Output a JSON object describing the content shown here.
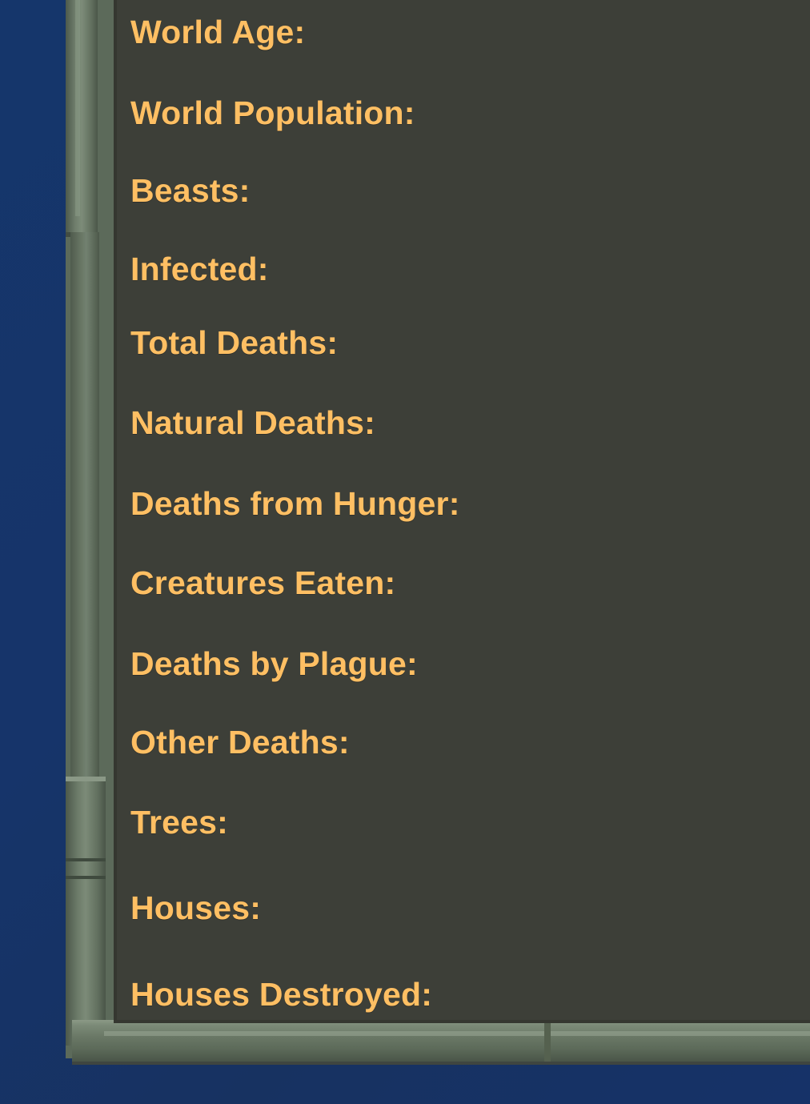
{
  "stats": {
    "world_age": "World Age:",
    "world_population": "World Population:",
    "beasts": "Beasts:",
    "infected": "Infected:",
    "total_deaths": "Total Deaths:",
    "natural_deaths": "Natural Deaths:",
    "deaths_from_hunger": "Deaths from Hunger:",
    "creatures_eaten": "Creatures Eaten:",
    "deaths_by_plague": "Deaths by Plague:",
    "other_deaths": "Other Deaths:",
    "trees": "Trees:",
    "houses": "Houses:",
    "houses_destroyed": "Houses Destroyed:"
  },
  "colors": {
    "label": "#ffbf63",
    "panel": "#3d3f38",
    "frame": "#6f7e6c",
    "background": "#15366b"
  }
}
